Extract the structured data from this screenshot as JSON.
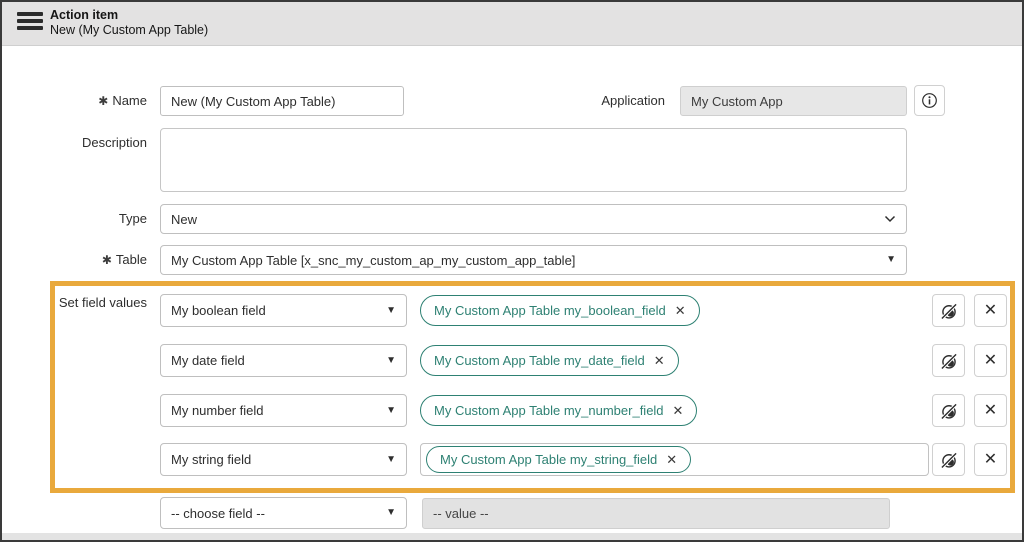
{
  "header": {
    "title": "Action item",
    "subtitle": "New (My Custom App Table)"
  },
  "icons": {
    "hamburger": "menu",
    "info": "info-circle",
    "dropdown_arrow": "▼",
    "select_chevron": "chevron-down",
    "close": "✕",
    "hide_value": "crossed-eye",
    "required_marker": "✱"
  },
  "form": {
    "name": {
      "label": "Name",
      "value": "New (My Custom App Table)"
    },
    "application": {
      "label": "Application",
      "value": "My Custom App"
    },
    "description": {
      "label": "Description",
      "value": ""
    },
    "type": {
      "label": "Type",
      "value": "New"
    },
    "table": {
      "label": "Table",
      "value": "My Custom App Table [x_snc_my_custom_ap_my_custom_app_table]"
    },
    "set_field_values": {
      "label": "Set field values",
      "rows": [
        {
          "field": "My boolean field",
          "pill": "My Custom App Table my_boolean_field"
        },
        {
          "field": "My date field",
          "pill": "My Custom App Table my_date_field"
        },
        {
          "field": "My number field",
          "pill": "My Custom App Table my_number_field"
        },
        {
          "field": "My string field",
          "pill": "My Custom App Table my_string_field"
        }
      ],
      "empty_row": {
        "field_placeholder": "-- choose field --",
        "value_placeholder": "-- value --"
      }
    }
  },
  "colors": {
    "accent_teal": "#2E8173",
    "highlight": "#E9A93C",
    "header_bg": "#e3e2e2"
  }
}
